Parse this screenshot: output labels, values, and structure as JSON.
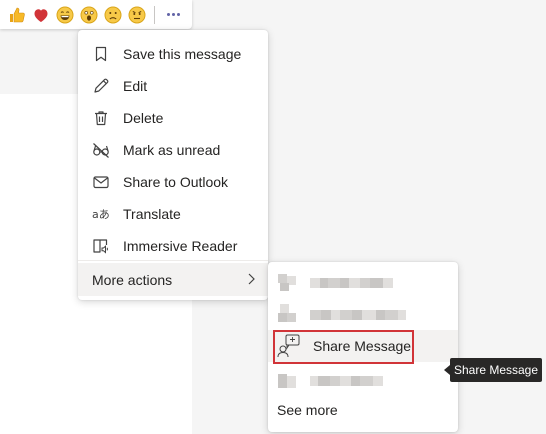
{
  "reactions": [
    {
      "icon": "thumbs-up-icon",
      "color": "#f7b928"
    },
    {
      "icon": "heart-icon",
      "color": "#d13438"
    },
    {
      "icon": "laugh-icon",
      "color": "#f7c948"
    },
    {
      "icon": "surprised-icon",
      "color": "#f7c948"
    },
    {
      "icon": "sad-icon",
      "color": "#f7c948"
    },
    {
      "icon": "angry-icon",
      "color": "#f7c948"
    }
  ],
  "more_options_icon": "more-options-icon",
  "menu": {
    "items": [
      {
        "label": "Save this message",
        "icon": "bookmark-icon"
      },
      {
        "label": "Edit",
        "icon": "pencil-icon"
      },
      {
        "label": "Delete",
        "icon": "trash-icon"
      },
      {
        "label": "Mark as unread",
        "icon": "glasses-icon"
      },
      {
        "label": "Share to Outlook",
        "icon": "mail-icon"
      },
      {
        "label": "Translate",
        "icon": "translate-icon"
      },
      {
        "label": "Immersive Reader",
        "icon": "immersive-reader-icon"
      }
    ],
    "more_actions_label": "More actions"
  },
  "submenu": {
    "share_label": "Share Message",
    "see_more_label": "See more"
  },
  "tooltip": {
    "text": "Share Message"
  },
  "colors": {
    "accent": "#6264a7",
    "highlight_border": "#d13438",
    "tooltip_bg": "#292827"
  }
}
